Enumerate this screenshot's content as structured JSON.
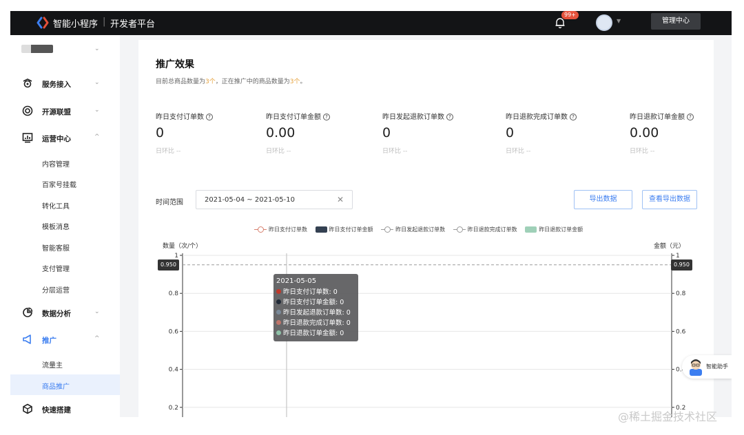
{
  "header": {
    "brand": "智能小程序",
    "separator": "|",
    "subtitle": "开发者平台",
    "notification_badge": "99+",
    "admin_button": "管理中心"
  },
  "sidebar": {
    "items": [
      {
        "label": "服务接入",
        "icon": "service-icon",
        "chevron": "⌄"
      },
      {
        "label": "开源联盟",
        "icon": "alliance-icon",
        "chevron": "⌄"
      },
      {
        "label": "运营中心",
        "icon": "operations-icon",
        "chevron": "^"
      },
      {
        "label": "数据分析",
        "icon": "analytics-icon",
        "chevron": "⌄"
      },
      {
        "label": "推广",
        "icon": "promotion-icon",
        "chevron": "^"
      },
      {
        "label": "快速搭建",
        "icon": "build-icon",
        "chevron": ""
      }
    ],
    "ops_children": [
      "内容管理",
      "百家号挂载",
      "转化工具",
      "模板消息",
      "智能客服",
      "支付管理",
      "分层运营"
    ],
    "promo_children": [
      "流量主",
      "商品推广"
    ],
    "account_chevron": "⌄"
  },
  "main": {
    "title": "推广效果",
    "desc_prefix": "目前总商品数量为",
    "desc_count1": "3个",
    "desc_mid": "，正在推广中的商品数量为",
    "desc_count2": "3个",
    "desc_suffix": "。",
    "metrics": [
      {
        "label": "昨日支付订单数",
        "value": "0",
        "compare": "日环比 --"
      },
      {
        "label": "昨日支付订单金额",
        "value": "0.00",
        "compare": "日环比 --"
      },
      {
        "label": "昨日发起退款订单数",
        "value": "0",
        "compare": "日环比 --"
      },
      {
        "label": "昨日退款完成订单数",
        "value": "0",
        "compare": "日环比 --"
      },
      {
        "label": "昨日退款订单金额",
        "value": "0.00",
        "compare": "日环比 --"
      }
    ],
    "help_glyph": "?",
    "range_label": "时间范围",
    "range_value": "2021-05-04 ~ 2021-05-10",
    "clear_glyph": "✕",
    "export_button": "导出数据",
    "view_export_button": "查看导出数据"
  },
  "chart_data": {
    "type": "line",
    "legend": [
      {
        "name": "昨日支付订单数",
        "style": "line",
        "color": "#d77f6d"
      },
      {
        "name": "昨日支付订单金额",
        "style": "bar",
        "color": "#344152"
      },
      {
        "name": "昨日发起退款订单数",
        "style": "line",
        "color": "#999999"
      },
      {
        "name": "昨日退款完成订单数",
        "style": "line",
        "color": "#999999"
      },
      {
        "name": "昨日退款订单金额",
        "style": "bar",
        "color": "#9fd0b8"
      }
    ],
    "y_left_title": "数量（次/个）",
    "y_right_title": "金额（元）",
    "y_ticks": [
      "1",
      "0.8",
      "0.6",
      "0.4",
      "0.2"
    ],
    "y_tick_values": [
      1,
      0.8,
      0.6,
      0.4,
      0.2
    ],
    "ylim": [
      0,
      1
    ],
    "marker_value": "0.950",
    "marker_level": 0.95,
    "tooltip": {
      "date": "2021-05-05",
      "rows": [
        {
          "label": "昨日支付订单数: 0",
          "color": "#c0392b"
        },
        {
          "label": "昨日支付订单金额: 0",
          "color": "#222b38"
        },
        {
          "label": "昨日发起退款订单数: 0",
          "color": "#7a8a9a"
        },
        {
          "label": "昨日退款完成订单数: 0",
          "color": "#c0756a"
        },
        {
          "label": "昨日退款订单金额: 0",
          "color": "#8fc2a8"
        }
      ]
    }
  },
  "assistant": {
    "label": "智能助手"
  },
  "watermark": "@稀土掘金技术社区"
}
